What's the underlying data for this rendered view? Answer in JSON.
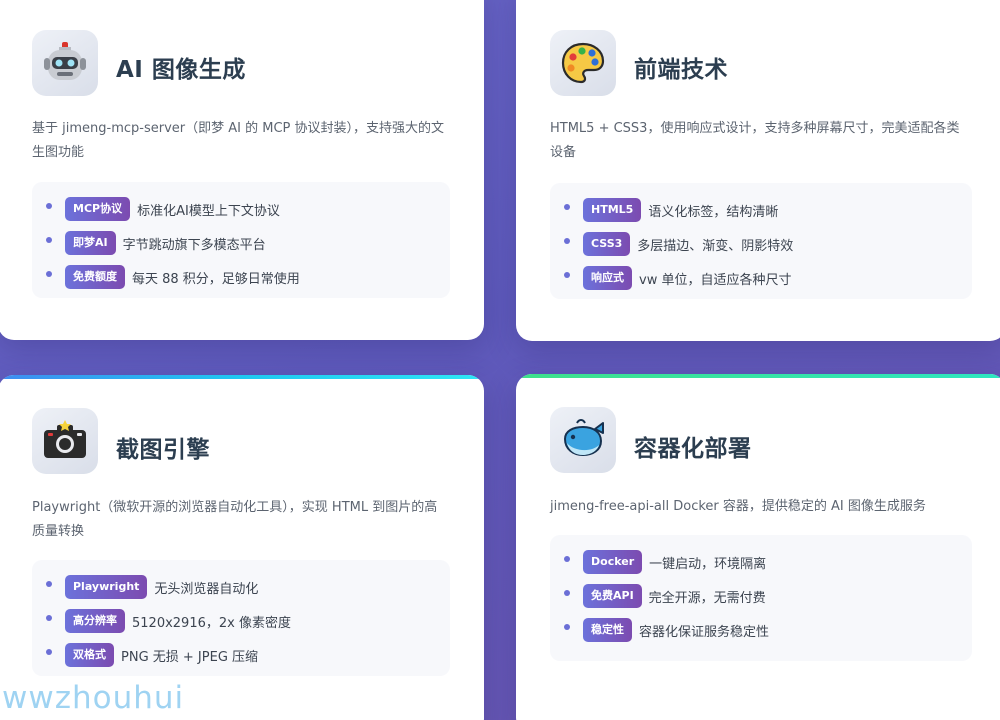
{
  "cards": [
    {
      "title": "AI 图像生成",
      "icon": "robot-icon",
      "accent": "#6a5acd",
      "description": "基于 jimeng-mcp-server（即梦 AI 的 MCP 协议封装），支持强大的文生图功能",
      "features": [
        {
          "badge": "MCP协议",
          "text": "标准化AI模型上下文协议"
        },
        {
          "badge": "即梦AI",
          "text": "字节跳动旗下多模态平台"
        },
        {
          "badge": "免费额度",
          "text": "每天 88 积分，足够日常使用"
        }
      ]
    },
    {
      "title": "前端技术",
      "icon": "palette-icon",
      "accent": "#f05d8c",
      "description": "HTML5 + CSS3，使用响应式设计，支持多种屏幕尺寸，完美适配各类设备",
      "features": [
        {
          "badge": "HTML5",
          "text": "语义化标签，结构清晰"
        },
        {
          "badge": "CSS3",
          "text": "多层描边、渐变、阴影特效"
        },
        {
          "badge": "响应式",
          "text": "vw 单位，自适应各种尺寸"
        }
      ]
    },
    {
      "title": "截图引擎",
      "icon": "camera-icon",
      "accent": "#1fc8f0",
      "description": "Playwright（微软开源的浏览器自动化工具），实现 HTML 到图片的高质量转换",
      "features": [
        {
          "badge": "Playwright",
          "text": "无头浏览器自动化"
        },
        {
          "badge": "高分辨率",
          "text": "5120x2916，2x 像素密度"
        },
        {
          "badge": "双格式",
          "text": "PNG 无损 + JPEG 压缩"
        }
      ]
    },
    {
      "title": "容器化部署",
      "icon": "whale-icon",
      "accent": "#3fe08a",
      "description": "jimeng-free-api-all Docker 容器，提供稳定的 AI 图像生成服务",
      "features": [
        {
          "badge": "Docker",
          "text": "一键启动，环境隔离"
        },
        {
          "badge": "免费API",
          "text": "完全开源，无需付费"
        },
        {
          "badge": "稳定性",
          "text": "容器化保证服务稳定性"
        }
      ]
    }
  ],
  "watermark": "wwzhouhui"
}
